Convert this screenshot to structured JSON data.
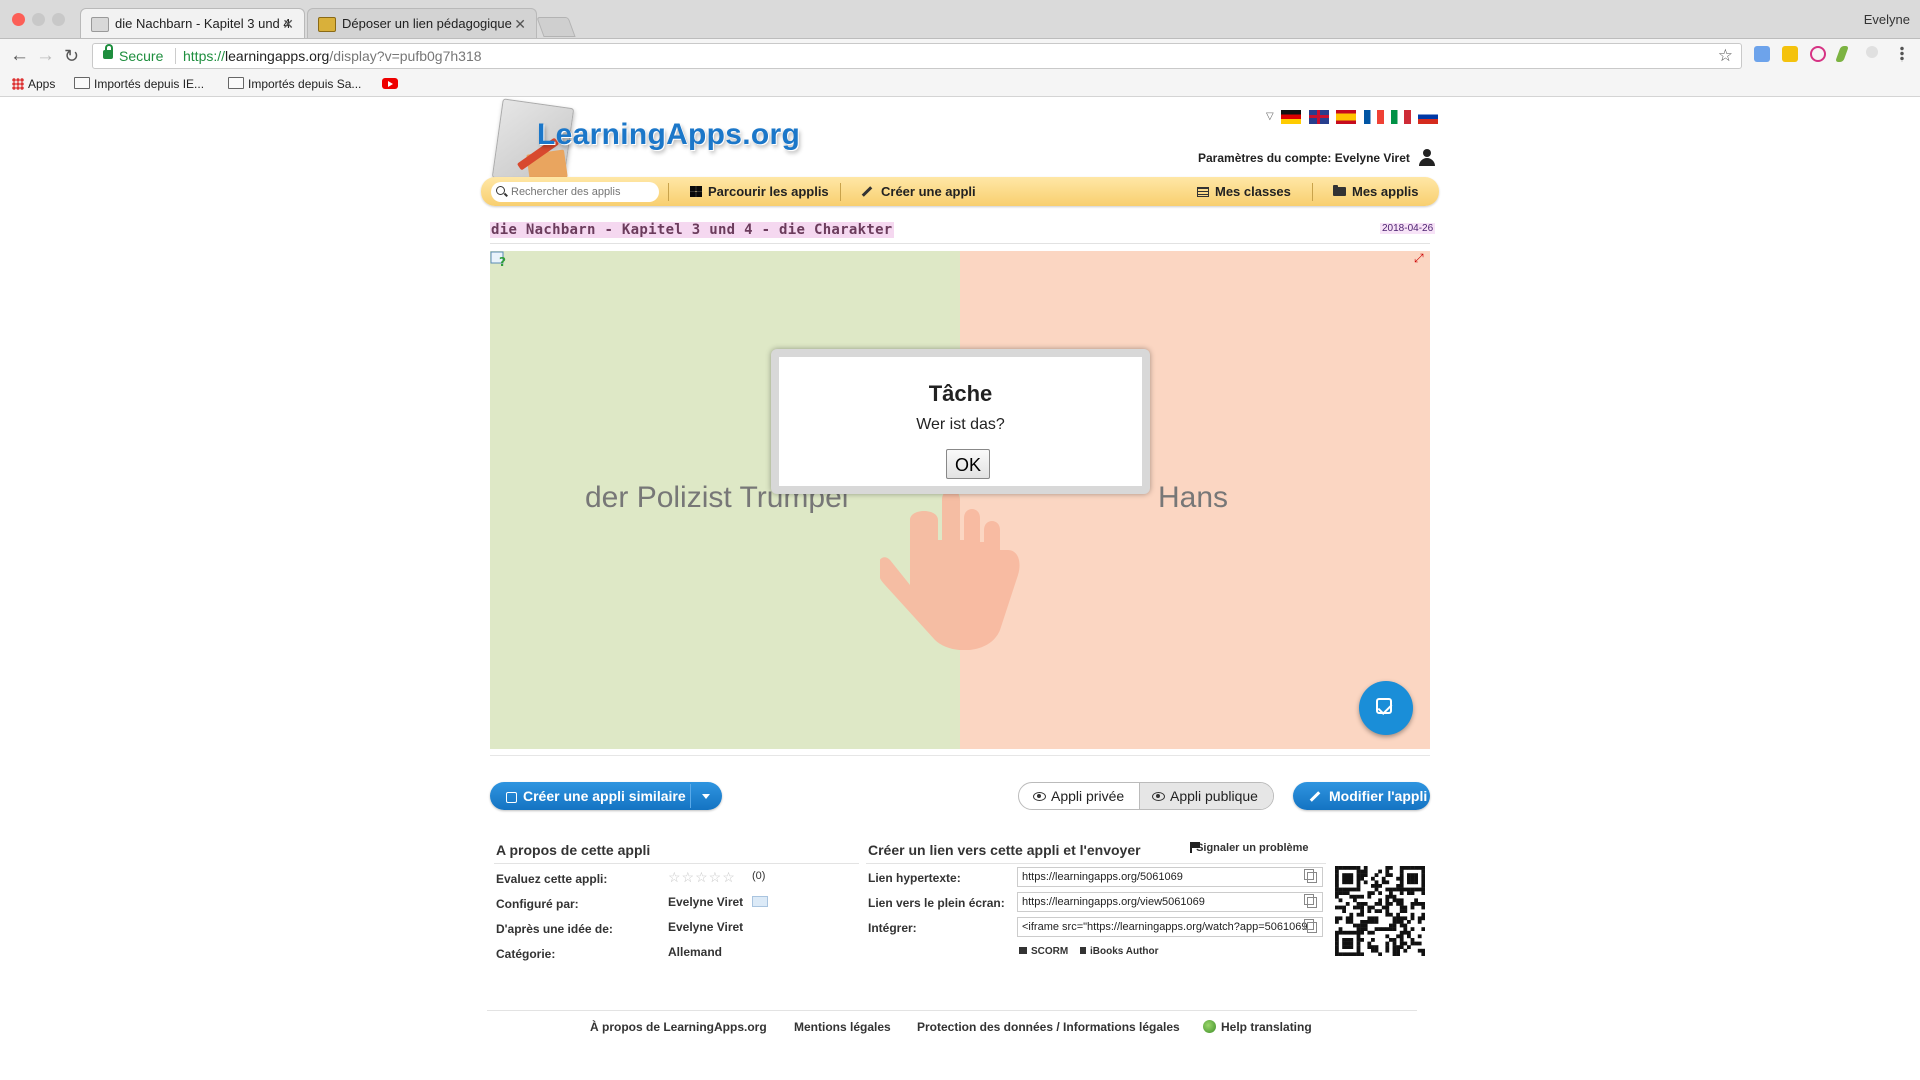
{
  "browser": {
    "tabs": [
      {
        "title": "die Nachbarn - Kapitel 3 und 4",
        "close": "✕"
      },
      {
        "title": "Déposer un lien pédagogique",
        "close": "✕"
      }
    ],
    "profile": "Evelyne",
    "secure_label": "Secure",
    "url_scheme": "https://",
    "url_host": "learningapps.org",
    "url_path": "/display?v=pufb0g7h318",
    "bookmarks": [
      "Apps",
      "Importés depuis IE...",
      "Importés depuis Sa..."
    ]
  },
  "site": {
    "logo": "LearningApps.org",
    "account_label": "Paramètres du compte: Evelyne Viret",
    "search_placeholder": "Rechercher des applis",
    "nav": {
      "browse": "Parcourir les applis",
      "create": "Créer une appli",
      "classes": "Mes classes",
      "myapps": "Mes applis"
    },
    "colors": {
      "accent": "#1a8ed8",
      "nav_bg": "#f8cf6f"
    }
  },
  "app": {
    "title": "die Nachbarn - Kapitel 3 und 4 - die Charakter",
    "date": "2018-04-26",
    "left_word": "der Polizist Trumpel",
    "right_word": "Hans",
    "modal": {
      "title": "Tâche",
      "text": "Wer ist das?",
      "ok": "OK"
    }
  },
  "actions": {
    "create_similar": "Créer une appli similaire",
    "private": "Appli privée",
    "public": "Appli publique",
    "modify": "Modifier l'appli"
  },
  "about": {
    "heading": "A propos de cette appli",
    "rate_label": "Evaluez cette appli:",
    "stars": "☆☆☆☆☆",
    "rating_count": "(0)",
    "configured_label": "Configuré par:",
    "configured_value": "Evelyne Viret",
    "idea_label": "D'après une idée de:",
    "idea_value": "Evelyne Viret",
    "category_label": "Catégorie:",
    "category_value": "Allemand"
  },
  "share": {
    "heading": "Créer un lien vers cette appli et l'envoyer",
    "report": "Signaler un problème",
    "link_label": "Lien hypertexte:",
    "link_value": "https://learningapps.org/5061069",
    "fullscreen_label": "Lien vers le plein écran:",
    "fullscreen_value": "https://learningapps.org/view5061069",
    "embed_label": "Intégrer:",
    "embed_value": "<iframe src=\"https://learningapps.org/watch?app=5061069\"",
    "scorm": "SCORM",
    "ibooks": "iBooks Author"
  },
  "footer": {
    "about": "À propos de LearningApps.org",
    "legal": "Mentions légales",
    "privacy": "Protection des données / Informations légales",
    "translate": "Help translating"
  }
}
